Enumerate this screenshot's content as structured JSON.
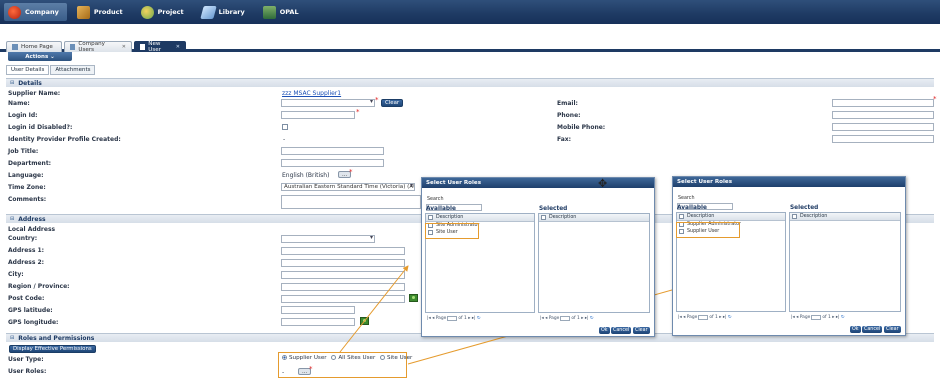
{
  "nav": {
    "items": [
      {
        "label": "Company",
        "icon": "company-icon",
        "active": true
      },
      {
        "label": "Product",
        "icon": "product-icon"
      },
      {
        "label": "Project",
        "icon": "project-icon"
      },
      {
        "label": "Library",
        "icon": "library-icon"
      },
      {
        "label": "OPAL",
        "icon": "opal-icon"
      }
    ]
  },
  "page_tabs": [
    {
      "label": "Home Page"
    },
    {
      "label": "Company Users",
      "closable": true
    },
    {
      "label": "New User",
      "closable": true,
      "active": true
    }
  ],
  "actions_label": "Actions",
  "sub_tabs": [
    "User Details",
    "Attachments"
  ],
  "details": {
    "heading": "Details",
    "supplier_name_label": "Supplier Name:",
    "supplier_name_value": "zzz MSAC Supplier1",
    "name_label": "Name:",
    "clear_button": "Clear",
    "login_id_label": "Login Id:",
    "login_disabled_label": "Login id Disabled?:",
    "idp_label": "Identity Provider Profile Created:",
    "idp_value": "-",
    "job_title_label": "Job Title:",
    "department_label": "Department:",
    "language_label": "Language:",
    "language_value": "English (British)",
    "language_button": "...",
    "timezone_label": "Time Zone:",
    "timezone_value": "Australian Eastern Standard Time (Victoria) (AUS Eastern Standard Time)",
    "comments_label": "Comments:",
    "email_label": "Email:",
    "phone_label": "Phone:",
    "mobile_label": "Mobile Phone:",
    "fax_label": "Fax:"
  },
  "address": {
    "heading": "Address",
    "local_address_label": "Local Address",
    "country_label": "Country:",
    "address1_label": "Address 1:",
    "address2_label": "Address 2:",
    "city_label": "City:",
    "region_label": "Region / Province:",
    "postcode_label": "Post Code:",
    "gps_lat_label": "GPS latitude:",
    "gps_lon_label": "GPS longitude:"
  },
  "roles": {
    "heading": "Roles and Permissions",
    "effective_button": "Display Effective Permissions",
    "user_type_label": "User Type:",
    "user_type_options": [
      "Supplier User",
      "All Sites User",
      "Site User"
    ],
    "user_type_selected": "Supplier User",
    "user_roles_label": "User Roles:",
    "user_roles_value": "-",
    "user_roles_button": "..."
  },
  "dialog_left": {
    "title": "Select User Roles",
    "search_label": "Search",
    "available_label": "Available",
    "selected_label": "Selected",
    "column_header": "Description",
    "available_items": [
      "Site Administrator",
      "Site User"
    ],
    "pager_page": "Page",
    "pager_of": "of 1",
    "buttons": [
      "Ok",
      "Cancel",
      "Clear"
    ]
  },
  "dialog_right": {
    "title": "Select User Roles",
    "search_label": "Search",
    "available_label": "Available",
    "selected_label": "Selected",
    "column_header": "Description",
    "available_items": [
      "Supplier Administrator",
      "Supplier User"
    ],
    "pager_page": "Page",
    "pager_of": "of 1",
    "buttons": [
      "Ok",
      "Cancel",
      "Clear"
    ]
  },
  "colors": {
    "nav_bg": "#1e3a63",
    "highlight": "#e59b2e",
    "link": "#1a4fb5",
    "required": "#e02020"
  }
}
